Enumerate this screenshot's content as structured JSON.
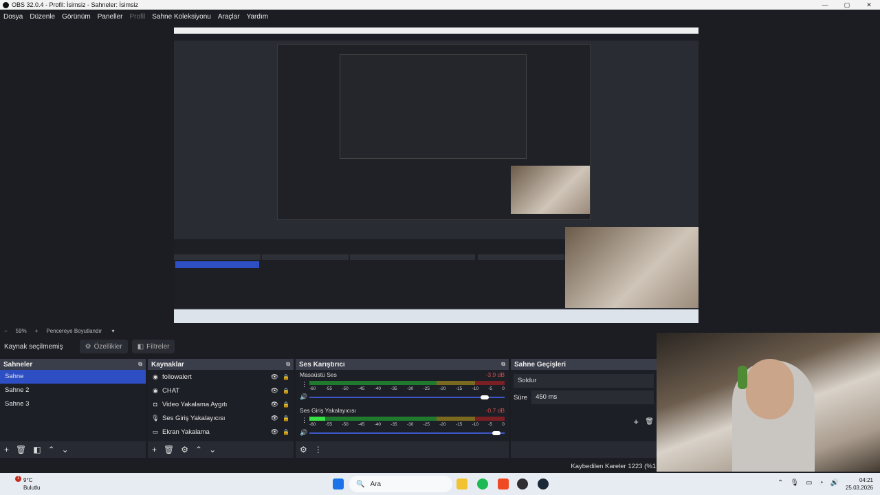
{
  "window": {
    "title": "OBS 32.0.4 - Profil: İsimsiz - Sahneler: İsimsiz",
    "controls": [
      "—",
      "▢",
      "✕"
    ]
  },
  "menu": [
    "Dosya",
    "Düzenle",
    "Görünüm",
    "Paneller",
    "Profil",
    "Sahne Koleksiyonu",
    "Araçlar",
    "Yardım"
  ],
  "zoom": {
    "minus": "−",
    "value": "59%",
    "plus": "+",
    "mode": "Pencereye Boyutlandır"
  },
  "context": {
    "label": "Kaynak seçilmemiş",
    "properties": "Özellikler",
    "filters": "Filtreler"
  },
  "scenes": {
    "title": "Sahneler",
    "items": [
      "Sahne",
      "Sahne 2",
      "Sahne 3"
    ],
    "selected": 0
  },
  "sources": {
    "title": "Kaynaklar",
    "items": [
      {
        "name": "followalert",
        "icon": "browser-icon"
      },
      {
        "name": "CHAT",
        "icon": "browser-icon"
      },
      {
        "name": "Video Yakalama Aygıtı",
        "icon": "camera-icon"
      },
      {
        "name": "Ses Giriş Yakalayıcısı",
        "icon": "microphone-icon"
      },
      {
        "name": "Ekran Yakalama",
        "icon": "monitor-icon"
      }
    ]
  },
  "mixer": {
    "title": "Ses Karıştırıcı",
    "ticks": [
      "-60",
      "-55",
      "-50",
      "-45",
      "-40",
      "-35",
      "-30",
      "-25",
      "-20",
      "-15",
      "-10",
      "-5",
      "0"
    ],
    "channels": [
      {
        "name": "Masaüstü Ses",
        "db": "-3.9 dB",
        "level": 0.0,
        "fader": 0.92
      },
      {
        "name": "Ses Giriş Yakalayıcısı",
        "db": "-0.7 dB",
        "level": 0.08,
        "fader": 0.98
      }
    ]
  },
  "transitions": {
    "title": "Sahne Geçişleri",
    "selected": "Soldur",
    "duration_label": "Süre",
    "duration_value": "450 ms"
  },
  "status": {
    "dropped": "Kaybedilen Kareler 1223 (%1"
  },
  "taskbar": {
    "weather_temp": "9°C",
    "weather_cond": "Bulutlu",
    "badge": "1",
    "search_placeholder": "Ara",
    "time": "04:21",
    "date": "25.03.2026"
  },
  "colors": {
    "accent": "#2e4fc4",
    "panel": "#272a33",
    "bg": "#1c1d22"
  }
}
